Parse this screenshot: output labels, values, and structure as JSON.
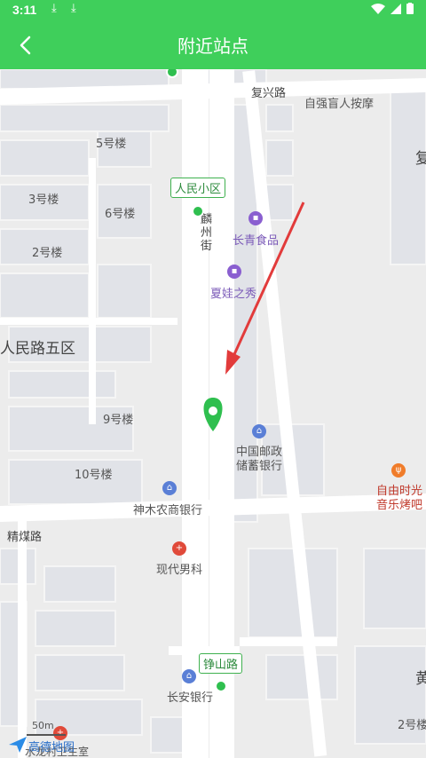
{
  "status_bar": {
    "time": "3:11"
  },
  "header": {
    "title": "附近站点"
  },
  "map": {
    "roads": {
      "fuxing": "复兴路",
      "linzhou": "麟州街",
      "jingmei": "精煤路",
      "zhengshan": "铮山路",
      "renmin_5": "人民路五区"
    },
    "buildings": [
      "5号楼",
      "3号楼",
      "6号楼",
      "2号楼",
      "9号楼",
      "10号楼",
      "2号楼"
    ],
    "pois": {
      "massage": "自强盲人按摩",
      "changqing": "长青食品",
      "xiawa": "夏娃之秀",
      "postal_line1": "中国邮政",
      "postal_line2": "储蓄银行",
      "shenmu_bank": "神木农商银行",
      "ziyou_line1": "自由时光",
      "ziyou_line2": "音乐烤吧",
      "xiandai": "现代男科",
      "changan_bank": "长安银行",
      "clinic": "水龙村卫生室",
      "edge_char_1": "复",
      "edge_char_2": "黄"
    },
    "stops": {
      "renmin_xiaoqu": "人民小区",
      "zhengshan_lu": "铮山路"
    },
    "scale": "50m",
    "logo": "高德地图"
  },
  "colors": {
    "accent": "#3fcf5b",
    "pin": "#2fbf4f",
    "arrow": "#e23b3b"
  }
}
